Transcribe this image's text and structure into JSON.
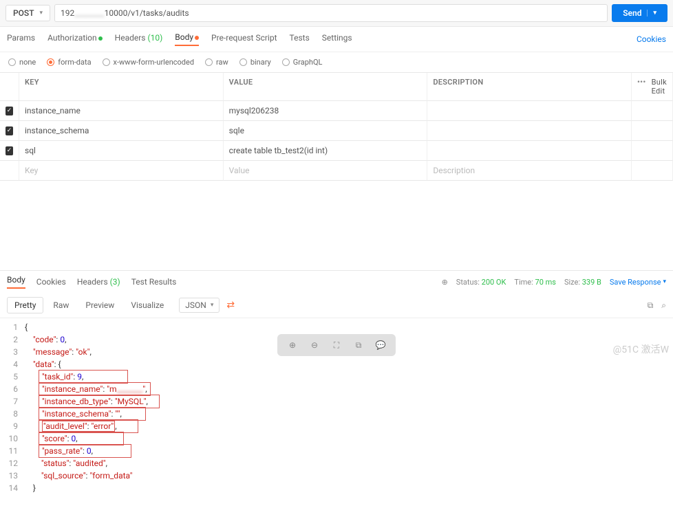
{
  "request": {
    "method": "POST",
    "url_prefix": "192",
    "url_blur": "________",
    "url_suffix": "10000/v1/tasks/audits",
    "send_label": "Send"
  },
  "req_tabs": {
    "params": "Params",
    "auth": "Authorization",
    "headers": "Headers",
    "headers_count": "(10)",
    "body": "Body",
    "prereq": "Pre-request Script",
    "tests": "Tests",
    "settings": "Settings",
    "cookies": "Cookies"
  },
  "body_types": {
    "none": "none",
    "formdata": "form-data",
    "xwww": "x-www-form-urlencoded",
    "raw": "raw",
    "binary": "binary",
    "graphql": "GraphQL"
  },
  "table": {
    "hdr_key": "KEY",
    "hdr_val": "VALUE",
    "hdr_desc": "DESCRIPTION",
    "bulk": "Bulk Edit",
    "rows": [
      {
        "k": "instance_name",
        "v": "mysql206238",
        "d": ""
      },
      {
        "k": "instance_schema",
        "v": "sqle",
        "d": ""
      },
      {
        "k": "sql",
        "v": "create table tb_test2(id int)",
        "d": ""
      }
    ],
    "ph_key": "Key",
    "ph_val": "Value",
    "ph_desc": "Description"
  },
  "resp_tabs": {
    "body": "Body",
    "cookies": "Cookies",
    "headers": "Headers",
    "headers_count": "(3)",
    "tests": "Test Results",
    "status_lbl": "Status:",
    "status": "200 OK",
    "time_lbl": "Time:",
    "time": "70 ms",
    "size_lbl": "Size:",
    "size": "339 B",
    "save": "Save Response"
  },
  "view": {
    "pretty": "Pretty",
    "raw": "Raw",
    "preview": "Preview",
    "visualize": "Visualize",
    "format": "JSON"
  },
  "json_lines": [
    {
      "n": 1,
      "t": "{"
    },
    {
      "n": 2,
      "t": "    \"code\": 0,"
    },
    {
      "n": 3,
      "t": "    \"message\": \"ok\","
    },
    {
      "n": 4,
      "t": "    \"data\": {"
    },
    {
      "n": 5,
      "t": "        \"task_id\": 9,"
    },
    {
      "n": 6,
      "t": "        \"instance_name\": \"m_______\","
    },
    {
      "n": 7,
      "t": "        \"instance_db_type\": \"MySQL\","
    },
    {
      "n": 8,
      "t": "        \"instance_schema\": \"\","
    },
    {
      "n": 9,
      "t": "        \"audit_level\": \"error\","
    },
    {
      "n": 10,
      "t": "        \"score\": 0,"
    },
    {
      "n": 11,
      "t": "        \"pass_rate\": 0,"
    },
    {
      "n": 12,
      "t": "        \"status\": \"audited\","
    },
    {
      "n": 13,
      "t": "        \"sql_source\": \"form_data\""
    },
    {
      "n": 14,
      "t": "    }"
    }
  ],
  "watermark": "@51C 激活W"
}
